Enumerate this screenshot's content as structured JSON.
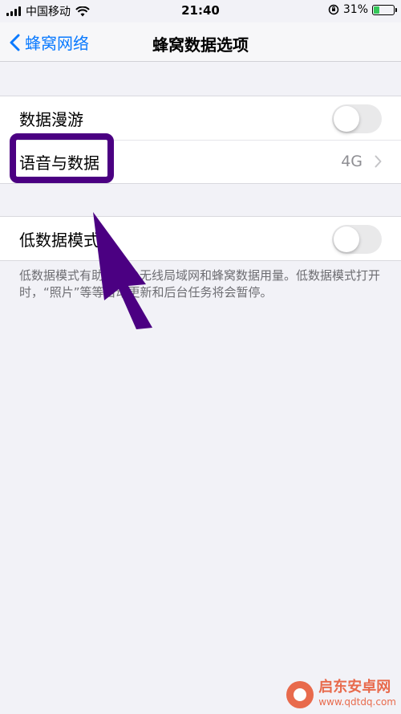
{
  "status_bar": {
    "carrier": "中国移动",
    "time": "21:40",
    "battery_percent": "31%",
    "battery_level": 0.31
  },
  "nav": {
    "back_label": "蜂窝网络",
    "title": "蜂窝数据选项"
  },
  "settings": {
    "data_roaming": {
      "label": "数据漫游",
      "enabled": false
    },
    "voice_data": {
      "label": "语音与数据",
      "value": "4G"
    },
    "low_data_mode": {
      "label": "低数据模式",
      "enabled": false,
      "footnote": "低数据模式有助于减少无线局域网和蜂窝数据用量。低数据模式打开时，“照片”等等自动更新和后台任务将会暂停。"
    }
  },
  "annotation": {
    "color": "#4b0082"
  },
  "watermark": {
    "name": "启东安卓网",
    "url": "www.qdtdq.com"
  },
  "colors": {
    "accent": "#0a7aff",
    "background": "#f2f2f7",
    "toggle_off": "#e9e9ea"
  },
  "icons": [
    "signal-icon",
    "wifi-icon",
    "orientation-lock-icon",
    "battery-icon",
    "back-chevron-icon",
    "chevron-right-icon"
  ]
}
